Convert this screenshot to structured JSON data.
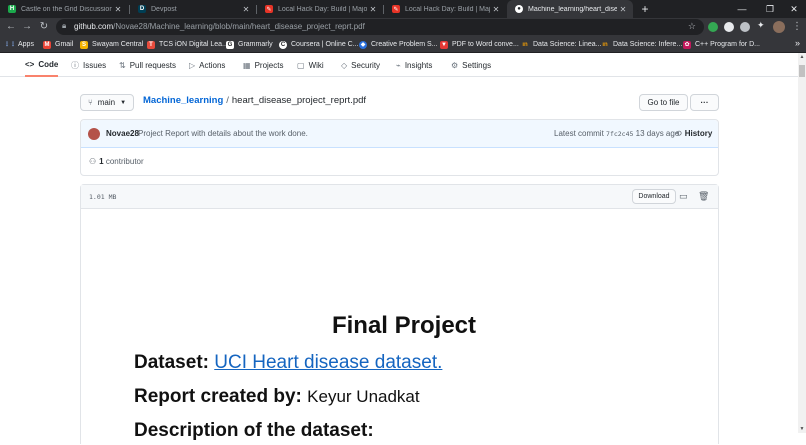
{
  "browser": {
    "tabs": [
      {
        "title": "Castle on the Grid Discussions | H",
        "favicon": "hackerrank"
      },
      {
        "title": "Devpost",
        "favicon": "devpost"
      },
      {
        "title": "Local Hack Day: Build | Major Lea",
        "favicon": "mlh"
      },
      {
        "title": "Local Hack Day: Build | Major Lea",
        "favicon": "mlh"
      },
      {
        "title": "Machine_learning/heart_disease",
        "favicon": "github",
        "active": true
      }
    ],
    "url_host": "github.com",
    "url_path": "/Novae28/Machine_learning/blob/main/heart_disease_project_reprt.pdf",
    "bookmarks": [
      {
        "label": "Apps",
        "icon": "apps-grid-icon"
      },
      {
        "label": "Gmail",
        "icon": "gmail-icon"
      },
      {
        "label": "Swayam Central",
        "icon": "swayam-icon"
      },
      {
        "label": "TCS iON Digital Lea...",
        "icon": "tcs-icon"
      },
      {
        "label": "Grammarly",
        "icon": "grammarly-icon"
      },
      {
        "label": "Coursera | Online C...",
        "icon": "coursera-icon"
      },
      {
        "label": "Creative Problem S...",
        "icon": "creative-icon"
      },
      {
        "label": "PDF to Word conve...",
        "icon": "pdf-icon"
      },
      {
        "label": "Data Science: Linea...",
        "icon": "edx-icon"
      },
      {
        "label": "Data Science: Infere...",
        "icon": "edx-icon"
      },
      {
        "label": "C++ Program for D...",
        "icon": "cpp-icon"
      }
    ]
  },
  "repo_nav": {
    "tabs": [
      "Code",
      "Issues",
      "Pull requests",
      "Actions",
      "Projects",
      "Wiki",
      "Security",
      "Insights",
      "Settings"
    ],
    "selected": "Code"
  },
  "file_nav": {
    "branch": "main",
    "repo": "Machine_learning",
    "separator": "/",
    "filename": "heart_disease_project_reprt.pdf",
    "go_to_file": "Go to file",
    "more": "···"
  },
  "commit": {
    "author": "Novae28",
    "message": "Project Report with details about the work done.",
    "latest_label": "Latest commit",
    "sha": "7fc2c45",
    "time": "13 days ago",
    "history_label": "History",
    "contributors_count": "1",
    "contributors_label": "contributor"
  },
  "file": {
    "size": "1.01 MB",
    "download_label": "Download"
  },
  "pdf": {
    "title": "Final Project",
    "dataset_label": "Dataset:",
    "dataset_link": "UCI Heart disease dataset.",
    "report_label": "Report created by:",
    "report_author": "Keyur Unadkat",
    "description_heading": "Description of the dataset:"
  }
}
